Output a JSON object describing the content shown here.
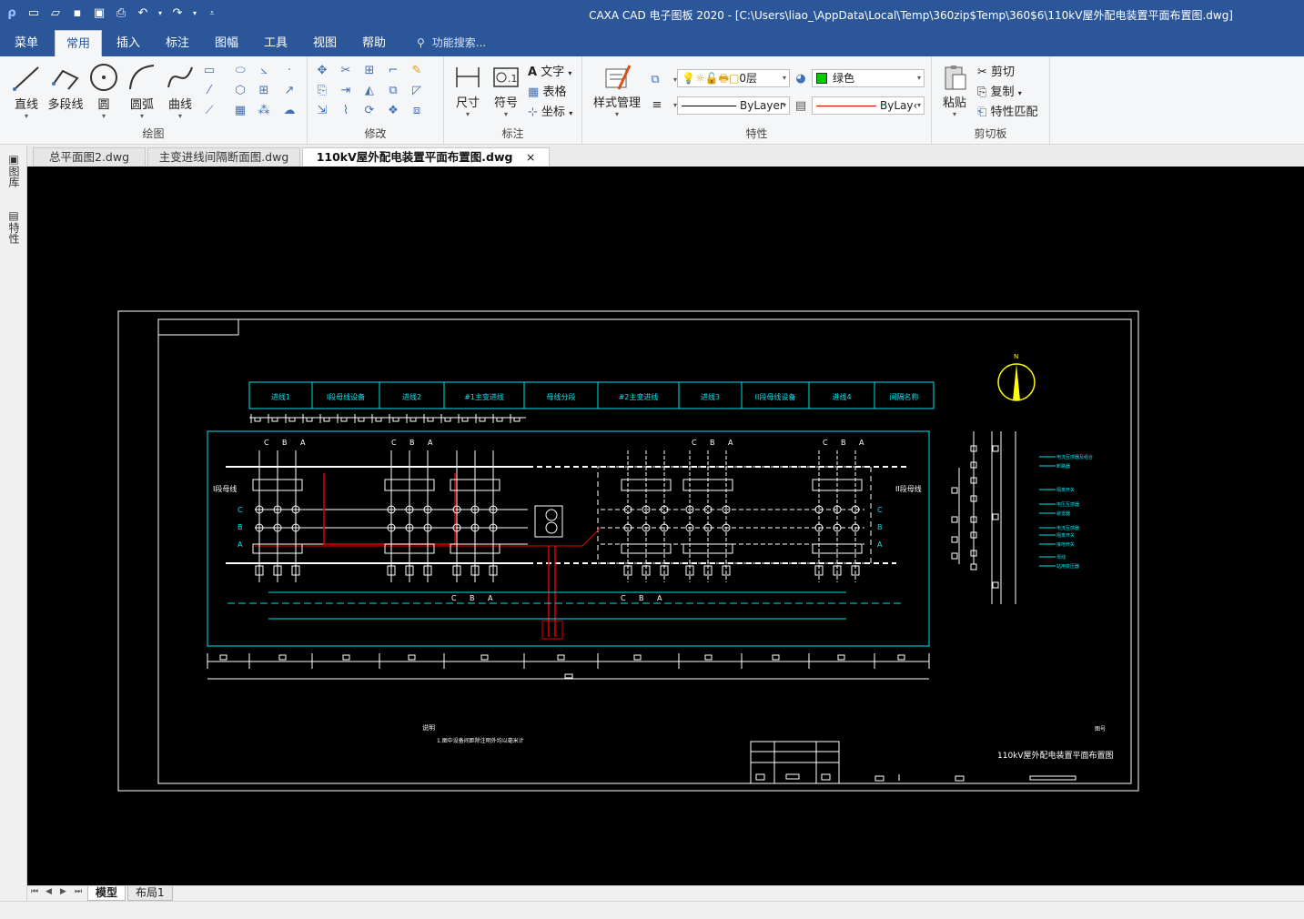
{
  "window": {
    "title": "CAXA CAD 电子图板 2020 - [C:\\Users\\liao_\\AppData\\Local\\Temp\\360zip$Temp\\360$6\\110kV屋外配电装置平面布置图.dwg]"
  },
  "menu": {
    "items": [
      "菜单",
      "常用",
      "插入",
      "标注",
      "图幅",
      "工具",
      "视图",
      "帮助"
    ],
    "active": "常用",
    "search_hint": "功能搜索..."
  },
  "ribbon": {
    "draw": {
      "label": "绘图",
      "tools": [
        "直线",
        "多段线",
        "圆",
        "圆弧",
        "曲线"
      ]
    },
    "modify": {
      "label": "修改"
    },
    "annotate": {
      "label": "标注",
      "tools": [
        "尺寸",
        "符号"
      ],
      "small": [
        "文字",
        "表格",
        "坐标"
      ]
    },
    "properties": {
      "label": "特性",
      "style_manager": "样式管理",
      "layer": "0层",
      "color": "绿色",
      "color_hex": "#00cc00",
      "linetype": "ByLayer",
      "lineweight": "ByLay‹"
    },
    "clipboard": {
      "label": "剪切板",
      "paste": "粘贴",
      "items": [
        "剪切",
        "复制",
        "特性匹配"
      ]
    }
  },
  "doc_tabs": [
    "总平面图2.dwg",
    "主变进线间隔断面图.dwg",
    "110kV屋外配电装置平面布置图.dwg"
  ],
  "left_panel": [
    "图库",
    "特性"
  ],
  "layout_tabs": [
    "模型",
    "布局1"
  ],
  "drawing": {
    "header_cells": [
      "进线1",
      "I段母线设备",
      "进线2",
      "#1主变进线",
      "母线分段",
      "#2主变进线",
      "进线3",
      "II段母线设备",
      "进线4",
      "间隔名称"
    ],
    "phase_labels": [
      "C",
      "B",
      "A"
    ],
    "left_bus_label": "I段母线",
    "right_bus_label": "II段母线",
    "north": "N",
    "notes_title": "说明",
    "notes_text": "1.图中设备间距除注明外均以毫米计",
    "drawing_title": "110kV屋外配电装置平面布置图",
    "legend_items": [
      "电流互感器及组合",
      "断路器",
      "隔离开关",
      "电压互感器",
      "避雷器",
      "电流互感器",
      "隔离开关",
      "接地开关",
      "母线",
      "站用变压器"
    ],
    "colors": {
      "frame": "#ffffff",
      "cyan": "#00e5ee",
      "red": "#e00000",
      "yellow": "#ffff00"
    }
  }
}
